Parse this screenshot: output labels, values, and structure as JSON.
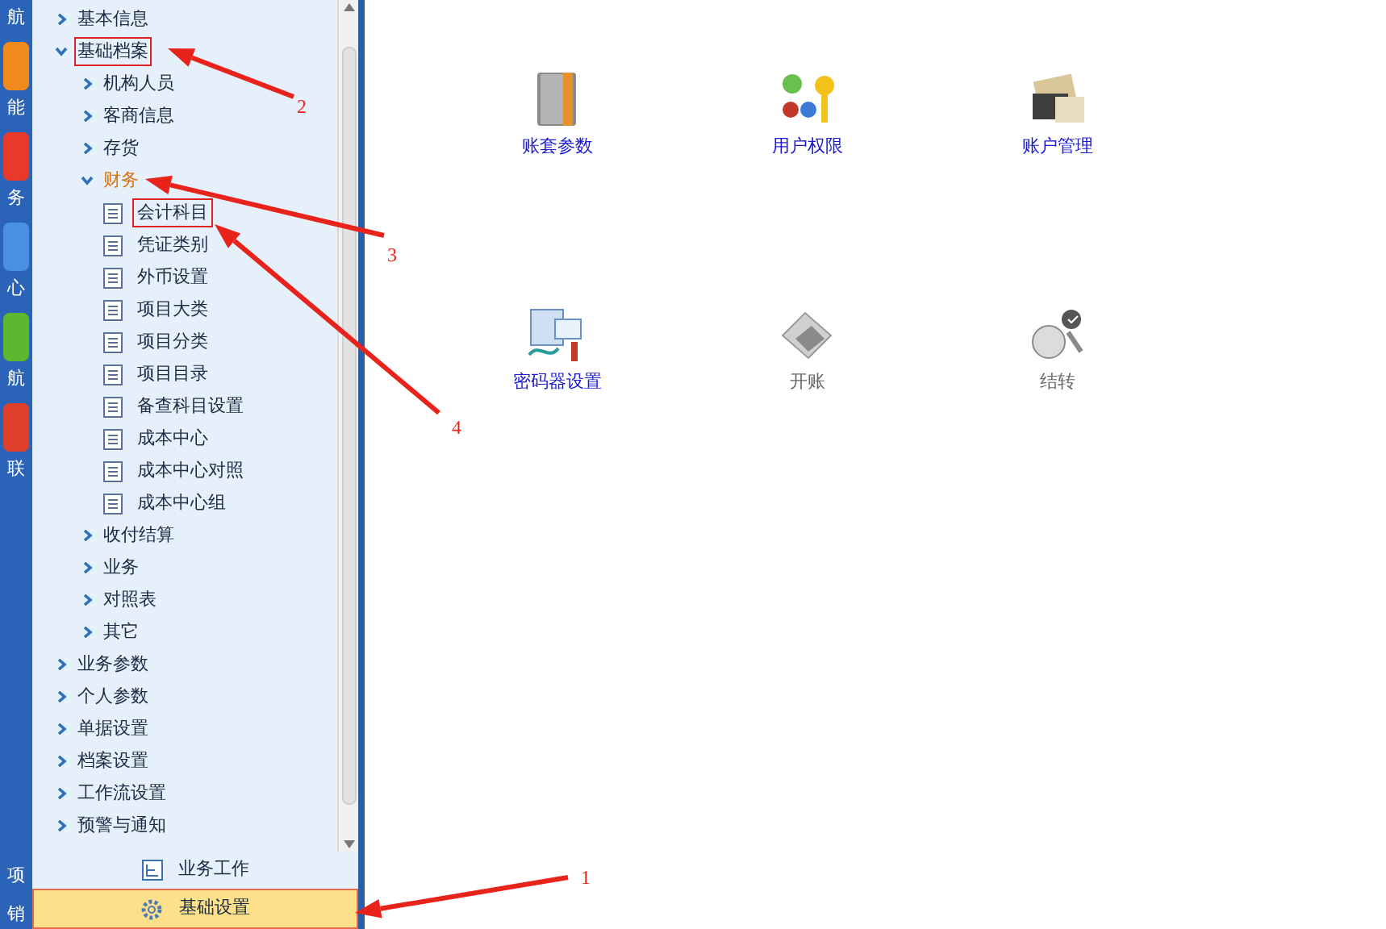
{
  "nav_strip": {
    "items": [
      {
        "label": "航"
      },
      {
        "label": "能",
        "color": "#f08a1c"
      },
      {
        "label": "务",
        "color": "#e8392b"
      },
      {
        "label": "心",
        "color": "#4a90e2"
      },
      {
        "label": "航",
        "color": "#5cb82e"
      },
      {
        "label": "联",
        "color": "#e0402a"
      }
    ],
    "bottom_items": [
      "项",
      "销"
    ]
  },
  "tree": [
    {
      "label": "基本信息",
      "expanded": false,
      "selected": false,
      "highlighted": false
    },
    {
      "label": "基础档案",
      "expanded": true,
      "selected": false,
      "highlighted": true,
      "children": [
        {
          "label": "机构人员",
          "expanded": false,
          "selected": false,
          "highlighted": false
        },
        {
          "label": "客商信息",
          "expanded": false,
          "selected": false,
          "highlighted": false
        },
        {
          "label": "存货",
          "expanded": false,
          "selected": false,
          "highlighted": false
        },
        {
          "label": "财务",
          "expanded": true,
          "selected": true,
          "highlighted": false,
          "children": [
            {
              "label": "会计科目",
              "selected": false,
              "highlighted": true
            },
            {
              "label": "凭证类别",
              "selected": false,
              "highlighted": false
            },
            {
              "label": "外币设置",
              "selected": false,
              "highlighted": false
            },
            {
              "label": "项目大类",
              "selected": false,
              "highlighted": false
            },
            {
              "label": "项目分类",
              "selected": false,
              "highlighted": false
            },
            {
              "label": "项目目录",
              "selected": false,
              "highlighted": false
            },
            {
              "label": "备查科目设置",
              "selected": false,
              "highlighted": false
            },
            {
              "label": "成本中心",
              "selected": false,
              "highlighted": false
            },
            {
              "label": "成本中心对照",
              "selected": false,
              "highlighted": false
            },
            {
              "label": "成本中心组",
              "selected": false,
              "highlighted": false
            }
          ]
        },
        {
          "label": "收付结算",
          "expanded": false,
          "selected": false,
          "highlighted": false
        },
        {
          "label": "业务",
          "expanded": false,
          "selected": false,
          "highlighted": false
        },
        {
          "label": "对照表",
          "expanded": false,
          "selected": false,
          "highlighted": false
        },
        {
          "label": "其它",
          "expanded": false,
          "selected": false,
          "highlighted": false
        }
      ]
    },
    {
      "label": "业务参数",
      "expanded": false,
      "selected": false,
      "highlighted": false
    },
    {
      "label": "个人参数",
      "expanded": false,
      "selected": false,
      "highlighted": false
    },
    {
      "label": "单据设置",
      "expanded": false,
      "selected": false,
      "highlighted": false
    },
    {
      "label": "档案设置",
      "expanded": false,
      "selected": false,
      "highlighted": false
    },
    {
      "label": "工作流设置",
      "expanded": false,
      "selected": false,
      "highlighted": false
    },
    {
      "label": "预警与通知",
      "expanded": false,
      "selected": false,
      "highlighted": false
    }
  ],
  "bottom_tabs": [
    {
      "label": "业务工作",
      "kind": "work",
      "selected": false
    },
    {
      "label": "基础设置",
      "kind": "gear",
      "selected": true
    }
  ],
  "functions": [
    {
      "label": "账套参数",
      "kind": "book",
      "enabled": true
    },
    {
      "label": "用户权限",
      "kind": "users",
      "enabled": true
    },
    {
      "label": "账户管理",
      "kind": "accounts",
      "enabled": true
    },
    {
      "label": "密码器设置",
      "kind": "device",
      "enabled": true
    },
    {
      "label": "开账",
      "kind": "open",
      "enabled": false
    },
    {
      "label": "结转",
      "kind": "carry",
      "enabled": false
    }
  ],
  "annotations": [
    "1",
    "2",
    "3",
    "4"
  ]
}
